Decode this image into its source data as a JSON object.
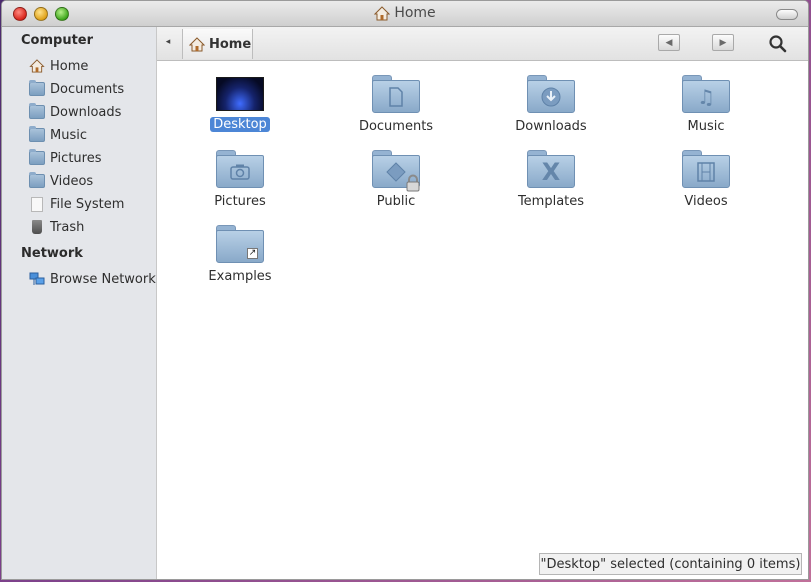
{
  "window": {
    "title": "Home"
  },
  "sidebar": {
    "sections": [
      {
        "heading": "Computer",
        "items": [
          {
            "label": "Home",
            "icon": "home-icon"
          },
          {
            "label": "Documents",
            "icon": "folder-icon"
          },
          {
            "label": "Downloads",
            "icon": "folder-icon"
          },
          {
            "label": "Music",
            "icon": "folder-icon"
          },
          {
            "label": "Pictures",
            "icon": "folder-icon"
          },
          {
            "label": "Videos",
            "icon": "folder-icon"
          },
          {
            "label": "File System",
            "icon": "file-icon"
          },
          {
            "label": "Trash",
            "icon": "trash-icon"
          }
        ]
      },
      {
        "heading": "Network",
        "items": [
          {
            "label": "Browse Network",
            "icon": "network-icon"
          }
        ]
      }
    ]
  },
  "toolbar": {
    "path_label": "Home"
  },
  "content": {
    "items": [
      {
        "label": "Desktop",
        "icon": "desktop-thumbnail",
        "selected": true
      },
      {
        "label": "Documents",
        "icon": "document-emblem"
      },
      {
        "label": "Downloads",
        "icon": "download-emblem"
      },
      {
        "label": "Music",
        "icon": "music-note-emblem"
      },
      {
        "label": "Pictures",
        "icon": "camera-emblem"
      },
      {
        "label": "Public",
        "icon": "lock-emblem"
      },
      {
        "label": "Templates",
        "icon": "x-emblem"
      },
      {
        "label": "Videos",
        "icon": "film-emblem"
      },
      {
        "label": "Examples",
        "icon": "shortcut-arrow-emblem"
      }
    ]
  },
  "status": {
    "text": "\"Desktop\" selected (containing 0 items)"
  },
  "colors": {
    "selection": "#4c86d6",
    "folder": "#89a9c9",
    "sidebar": "#e4e6ea"
  }
}
